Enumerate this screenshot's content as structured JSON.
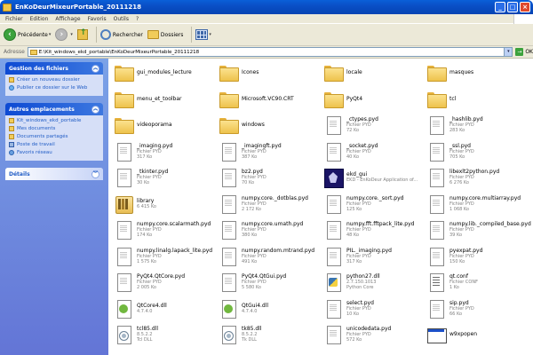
{
  "window": {
    "title": "EnKoDeurMixeurPortable_20111218"
  },
  "menu": [
    "Fichier",
    "Edition",
    "Affichage",
    "Favoris",
    "Outils",
    "?"
  ],
  "toolbar": {
    "back_label": "Précédente",
    "search_label": "Rechercher",
    "folders_label": "Dossiers"
  },
  "address": {
    "label": "Adresse",
    "value": "E:\\Kit_windows_ekd_portable\\EnKoDeurMixeurPortable_20111218",
    "go_label": "OK"
  },
  "taskpane": {
    "files_title": "Gestion des fichiers",
    "files_tasks": [
      "Créer un nouveau dossier",
      "Publier ce dossier sur le Web"
    ],
    "places_title": "Autres emplacements",
    "places": [
      "Kit_windows_ekd_portable",
      "Mes documents",
      "Documents partagés",
      "Poste de travail",
      "Favoris réseau"
    ],
    "details_title": "Détails"
  },
  "files": [
    {
      "name": "gui_modules_lecture",
      "type": "",
      "size": "",
      "icon": "folder-icon"
    },
    {
      "name": "Icones",
      "type": "",
      "size": "",
      "icon": "folder-icon"
    },
    {
      "name": "locale",
      "type": "",
      "size": "",
      "icon": "folder-icon"
    },
    {
      "name": "masques",
      "type": "",
      "size": "",
      "icon": "folder-icon"
    },
    {
      "name": "menu_et_toolbar",
      "type": "",
      "size": "",
      "icon": "folder-icon"
    },
    {
      "name": "Microsoft.VC90.CRT",
      "type": "",
      "size": "",
      "icon": "folder-icon"
    },
    {
      "name": "PyQt4",
      "type": "",
      "size": "",
      "icon": "folder-icon"
    },
    {
      "name": "tcl",
      "type": "",
      "size": "",
      "icon": "folder-icon"
    },
    {
      "name": "videoporama",
      "type": "",
      "size": "",
      "icon": "folder-icon"
    },
    {
      "name": "windows",
      "type": "",
      "size": "",
      "icon": "folder-icon"
    },
    {
      "name": "_ctypes.pyd",
      "type": "Fichier PYD",
      "size": "72 Ko",
      "icon": "file-icon"
    },
    {
      "name": "_hashlib.pyd",
      "type": "Fichier PYD",
      "size": "283 Ko",
      "icon": "file-icon"
    },
    {
      "name": "_imaging.pyd",
      "type": "Fichier PYD",
      "size": "317 Ko",
      "icon": "file-icon"
    },
    {
      "name": "_imagingft.pyd",
      "type": "Fichier PYD",
      "size": "387 Ko",
      "icon": "file-icon"
    },
    {
      "name": "_socket.pyd",
      "type": "Fichier PYD",
      "size": "40 Ko",
      "icon": "file-icon"
    },
    {
      "name": "_ssl.pyd",
      "type": "Fichier PYD",
      "size": "705 Ko",
      "icon": "file-icon"
    },
    {
      "name": "_tkinter.pyd",
      "type": "Fichier PYD",
      "size": "30 Ko",
      "icon": "file-icon"
    },
    {
      "name": "bz2.pyd",
      "type": "Fichier PYD",
      "size": "70 Ko",
      "icon": "file-icon"
    },
    {
      "name": "ekd_gui",
      "type": "EKD - EnKoDeur Application of...",
      "size": "",
      "icon": "app-icon"
    },
    {
      "name": "libexlt2python.pyd",
      "type": "Fichier PYD",
      "size": "6 276 Ko",
      "icon": "file-icon"
    },
    {
      "name": "library",
      "type": "6 415 Ko",
      "size": "",
      "icon": "library-icon"
    },
    {
      "name": "numpy.core._dotblas.pyd",
      "type": "Fichier PYD",
      "size": "2 172 Ko",
      "icon": "file-icon"
    },
    {
      "name": "numpy.core._sort.pyd",
      "type": "Fichier PYD",
      "size": "125 Ko",
      "icon": "file-icon"
    },
    {
      "name": "numpy.core.multiarray.pyd",
      "type": "Fichier PYD",
      "size": "1 068 Ko",
      "icon": "file-icon"
    },
    {
      "name": "numpy.core.scalarmath.pyd",
      "type": "Fichier PYD",
      "size": "174 Ko",
      "icon": "file-icon"
    },
    {
      "name": "numpy.core.umath.pyd",
      "type": "Fichier PYD",
      "size": "380 Ko",
      "icon": "file-icon"
    },
    {
      "name": "numpy.fft.fftpack_lite.pyd",
      "type": "Fichier PYD",
      "size": "48 Ko",
      "icon": "file-icon"
    },
    {
      "name": "numpy.lib._compiled_base.pyd",
      "type": "Fichier PYD",
      "size": "39 Ko",
      "icon": "file-icon"
    },
    {
      "name": "numpy.linalg.lapack_lite.pyd",
      "type": "Fichier PYD",
      "size": "1 575 Ko",
      "icon": "file-icon"
    },
    {
      "name": "numpy.random.mtrand.pyd",
      "type": "Fichier PYD",
      "size": "491 Ko",
      "icon": "file-icon"
    },
    {
      "name": "PIL._imaging.pyd",
      "type": "Fichier PYD",
      "size": "317 Ko",
      "icon": "file-icon"
    },
    {
      "name": "pyexpat.pyd",
      "type": "Fichier PYD",
      "size": "150 Ko",
      "icon": "file-icon"
    },
    {
      "name": "PyQt4.QtCore.pyd",
      "type": "Fichier PYD",
      "size": "2 005 Ko",
      "icon": "file-icon"
    },
    {
      "name": "PyQt4.QtGui.pyd",
      "type": "Fichier PYD",
      "size": "5 580 Ko",
      "icon": "file-icon"
    },
    {
      "name": "python27.dll",
      "type": "2.7.150.1013",
      "size": "Python Core",
      "icon": "python-icon"
    },
    {
      "name": "qt.conf",
      "type": "Fichier CONF",
      "size": "1 Ko",
      "icon": "conf-icon"
    },
    {
      "name": "QtCore4.dll",
      "type": "4.7.4.0",
      "size": "",
      "icon": "qt-icon"
    },
    {
      "name": "QtGui4.dll",
      "type": "4.7.4.0",
      "size": "",
      "icon": "qt-icon"
    },
    {
      "name": "select.pyd",
      "type": "Fichier PYD",
      "size": "10 Ko",
      "icon": "file-icon"
    },
    {
      "name": "sip.pyd",
      "type": "Fichier PYD",
      "size": "66 Ko",
      "icon": "file-icon"
    },
    {
      "name": "tcl85.dll",
      "type": "8.5.2.2",
      "size": "Tcl DLL",
      "icon": "dll-icon"
    },
    {
      "name": "tk85.dll",
      "type": "8.5.2.2",
      "size": "Tk DLL",
      "icon": "dll-icon"
    },
    {
      "name": "unicodedata.pyd",
      "type": "Fichier PYD",
      "size": "572 Ko",
      "icon": "file-icon"
    },
    {
      "name": "w9xpopen",
      "type": "",
      "size": "",
      "icon": "window-icon"
    }
  ]
}
